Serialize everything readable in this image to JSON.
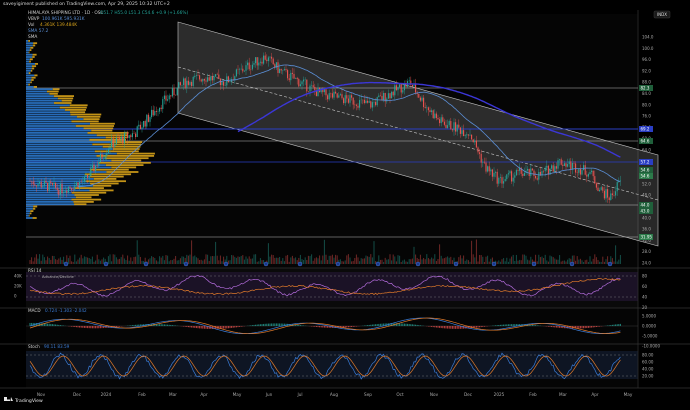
{
  "header": {
    "publisher": "saveyigiment published on TradingView.com, Apr 29, 2025 10:32 UTC+2",
    "symbol_box": "INDX"
  },
  "legend": {
    "title": "HIMALAYA SHIPPING LTD · 1D · OSL",
    "ohlc": "O51.7 H55.0 L51.3 C54.6 +0.9 (+1.66%)",
    "vbvp_label": "VBVP",
    "vbvp_values": "100.961K 595.931K",
    "vol_label": "Vol",
    "vol_values": "4.361K 139.484K",
    "sma1": "SMA 57.2",
    "sma2": "SMA"
  },
  "price_axis": {
    "ticks": [
      "104.0",
      "100.0",
      "96.0",
      "92.0",
      "88.0",
      "84.0",
      "80.0",
      "76.0",
      "72.0",
      "68.0",
      "64.0",
      "60.0",
      "56.0",
      "52.0",
      "48.0",
      "44.0",
      "40.0",
      "36.0",
      "32.0",
      "28.0",
      "24.0"
    ],
    "badges": [
      {
        "text": "82.3",
        "color": "#1f5f3a"
      },
      {
        "text": "69.2",
        "color": "#2a3ec4"
      },
      {
        "text": "64.6",
        "color": "#1f5f3a"
      },
      {
        "text": "57.2",
        "color": "#2a3ec4"
      },
      {
        "text": "54.6",
        "color": "#1f5f3a"
      },
      {
        "text": "54.6",
        "color": "#2c7a4a"
      },
      {
        "text": "44.0",
        "color": "#1f5f3a"
      },
      {
        "text": "43.0",
        "color": "#1f5f3a"
      },
      {
        "text": "31.95",
        "color": "#2c7a4a"
      }
    ]
  },
  "rsi": {
    "label": "RSI 14",
    "sublabel": "Advance/Decline",
    "ticks": [
      "80",
      "60",
      "40",
      "20"
    ],
    "left_ticks": [
      "40K",
      "20K",
      "0"
    ]
  },
  "macd": {
    "label": "MACD",
    "values": "0.724  -1.303  -2.042",
    "ticks": [
      "5.0000",
      "0.0000",
      "-5.0000",
      "-10.0000"
    ]
  },
  "stoch": {
    "label": "Stoch",
    "values": "90.11  83.59",
    "ticks": [
      "80.00",
      "60.00",
      "40.00",
      "20.00"
    ]
  },
  "time_axis": {
    "labels": [
      "Nov",
      "Dec",
      "2024",
      "Feb",
      "Mar",
      "Apr",
      "May",
      "Jun",
      "Jul",
      "Aug",
      "Sep",
      "Oct",
      "Nov",
      "Dec",
      "2025",
      "Feb",
      "Mar",
      "Apr",
      "May"
    ]
  },
  "brand": "TradingView",
  "colors": {
    "up": "#26a69a",
    "down": "#ef5350",
    "sma_fast": "#5b8fd6",
    "sma_slow": "#3b36d6",
    "channel": "#c8c8c8",
    "vp_up": "#2e7fd8",
    "vp_down": "#d8a31a",
    "rsi_bg": "#2a1a3e"
  }
}
